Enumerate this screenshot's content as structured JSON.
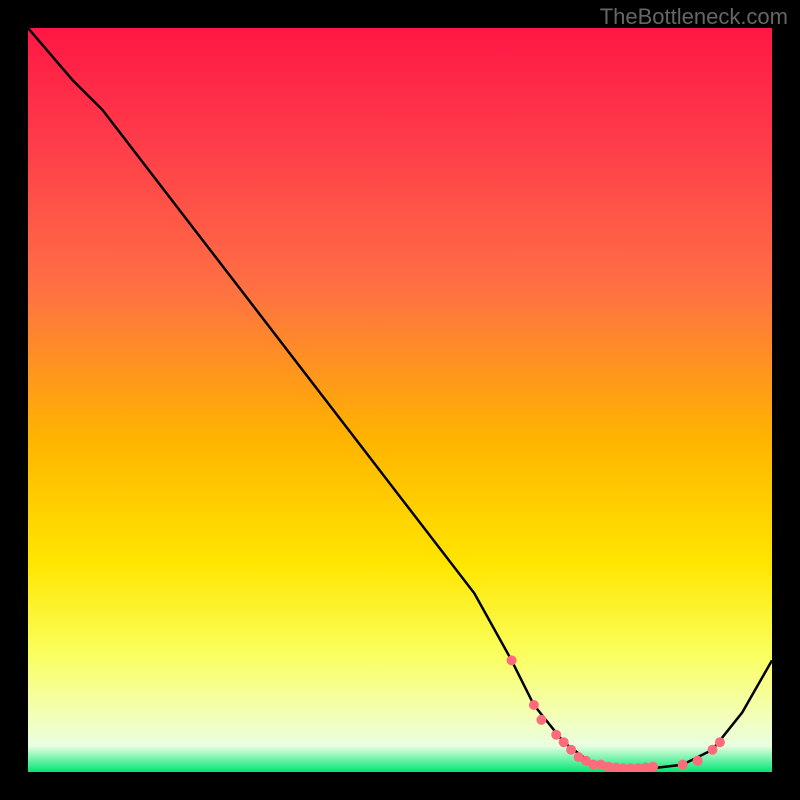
{
  "watermark": "TheBottleneck.com",
  "chart_data": {
    "type": "line",
    "title": "",
    "xlabel": "",
    "ylabel": "",
    "xlim": [
      0,
      100
    ],
    "ylim": [
      0,
      100
    ],
    "gradient_stops": [
      {
        "offset": 0,
        "color": "#ff1744"
      },
      {
        "offset": 0.15,
        "color": "#ff3b4a"
      },
      {
        "offset": 0.35,
        "color": "#ff7043"
      },
      {
        "offset": 0.55,
        "color": "#ffb300"
      },
      {
        "offset": 0.72,
        "color": "#ffe600"
      },
      {
        "offset": 0.84,
        "color": "#faff5c"
      },
      {
        "offset": 0.92,
        "color": "#f4ffb3"
      },
      {
        "offset": 0.965,
        "color": "#e8ffe0"
      },
      {
        "offset": 1.0,
        "color": "#00e676"
      }
    ],
    "series": [
      {
        "name": "bottleneck-curve",
        "color": "#000000",
        "x": [
          0,
          6,
          10,
          20,
          30,
          40,
          50,
          60,
          65,
          68,
          72,
          76,
          80,
          84,
          88,
          92,
          96,
          100
        ],
        "y": [
          100,
          93,
          89,
          76,
          63,
          50,
          37,
          24,
          15,
          9,
          4,
          1,
          0.5,
          0.5,
          1,
          3,
          8,
          15
        ]
      }
    ],
    "markers": {
      "name": "highlight-points",
      "color": "#ff6b7a",
      "radius": 5,
      "x": [
        65,
        68,
        69,
        71,
        72,
        73,
        74,
        75,
        76,
        77,
        78,
        79,
        80,
        81,
        82,
        83,
        84,
        88,
        90,
        92,
        93
      ],
      "y": [
        15,
        9,
        7,
        5,
        4,
        3,
        2,
        1.5,
        1,
        1,
        0.7,
        0.6,
        0.5,
        0.5,
        0.5,
        0.6,
        0.7,
        1,
        1.5,
        3,
        4
      ]
    }
  }
}
